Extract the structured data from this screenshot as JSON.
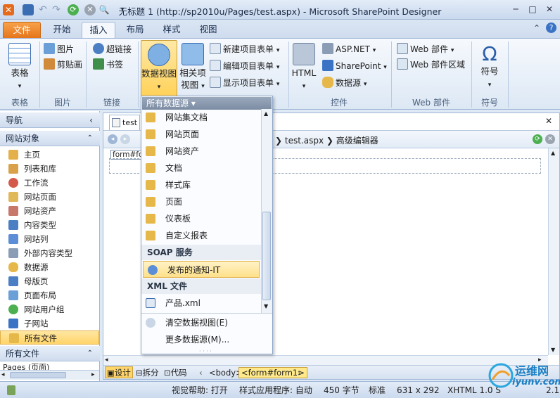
{
  "window": {
    "title": "无标题 1 (http://sp2010u/Pages/test.aspx) - Microsoft SharePoint Designer"
  },
  "ribbon_tabs": [
    "文件",
    "开始",
    "插入",
    "布局",
    "样式",
    "视图"
  ],
  "groups": {
    "table": {
      "button": "表格",
      "label": "表格"
    },
    "image": {
      "items": [
        "图片",
        "剪贴画"
      ],
      "label": "图片"
    },
    "link": {
      "items": [
        "超链接",
        "书签"
      ],
      "label": "链接"
    },
    "dataview": {
      "big1": "数据视图",
      "big2a": "相关项",
      "big2b": "视图",
      "items": [
        "新建项目表单",
        "编辑项目表单",
        "显示项目表单"
      ],
      "label": "数据视图"
    },
    "controls": {
      "big": "HTML",
      "items": [
        "ASP.NET",
        "SharePoint",
        "数据源"
      ],
      "label": "控件"
    },
    "webparts": {
      "items": [
        "Web 部件",
        "Web 部件区域"
      ],
      "label": "Web 部件"
    },
    "symbol": {
      "big": "符号",
      "label": "符号",
      "glyph": "Ω"
    }
  },
  "nav": {
    "title": "导航",
    "section": "网站对象",
    "items": [
      "主页",
      "列表和库",
      "工作流",
      "网站页面",
      "网站资产",
      "内容类型",
      "网站列",
      "外部内容类型",
      "数据源",
      "母版页",
      "页面布局",
      "网站用户组",
      "子网站",
      "所有文件"
    ],
    "section2": "所有文件",
    "bottom_partial": "Pages (页面)"
  },
  "doc": {
    "tab": "test",
    "breadcrumb": [
      "test.aspx",
      "高级编辑器"
    ],
    "tag_label": "form#fo"
  },
  "dropdown": {
    "header": "所有数据源 ▾",
    "items_top": [
      "网站集文档",
      "网站页面",
      "网站资产",
      "文档",
      "样式库",
      "页面",
      "仪表板",
      "自定义报表"
    ],
    "sec_soap": "SOAP 服务",
    "soap_item": "发布的通知-IT",
    "sec_xml": "XML 文件",
    "xml_item": "产品.xml",
    "clear": "清空数据视图(E)",
    "more": "更多数据源(M)..."
  },
  "viewbar": {
    "modes": [
      "设计",
      "拆分",
      "代码"
    ],
    "tags": [
      "<body>",
      "<form#form1>"
    ]
  },
  "status": {
    "help": "视觉帮助: 打开",
    "style": "样式应用程序: 自动",
    "bytes": "450 字节",
    "std": "标准",
    "size": "631 x 292",
    "doctype": "XHTML 1.0 S",
    "ver": "2.1"
  },
  "watermark": {
    "cn": "运维网",
    "url": "iyunv.com"
  },
  "colors": {
    "file_tab": "#e5751b",
    "highlight": "#ffd56a",
    "ribbon_border": "#9fb6d6"
  }
}
